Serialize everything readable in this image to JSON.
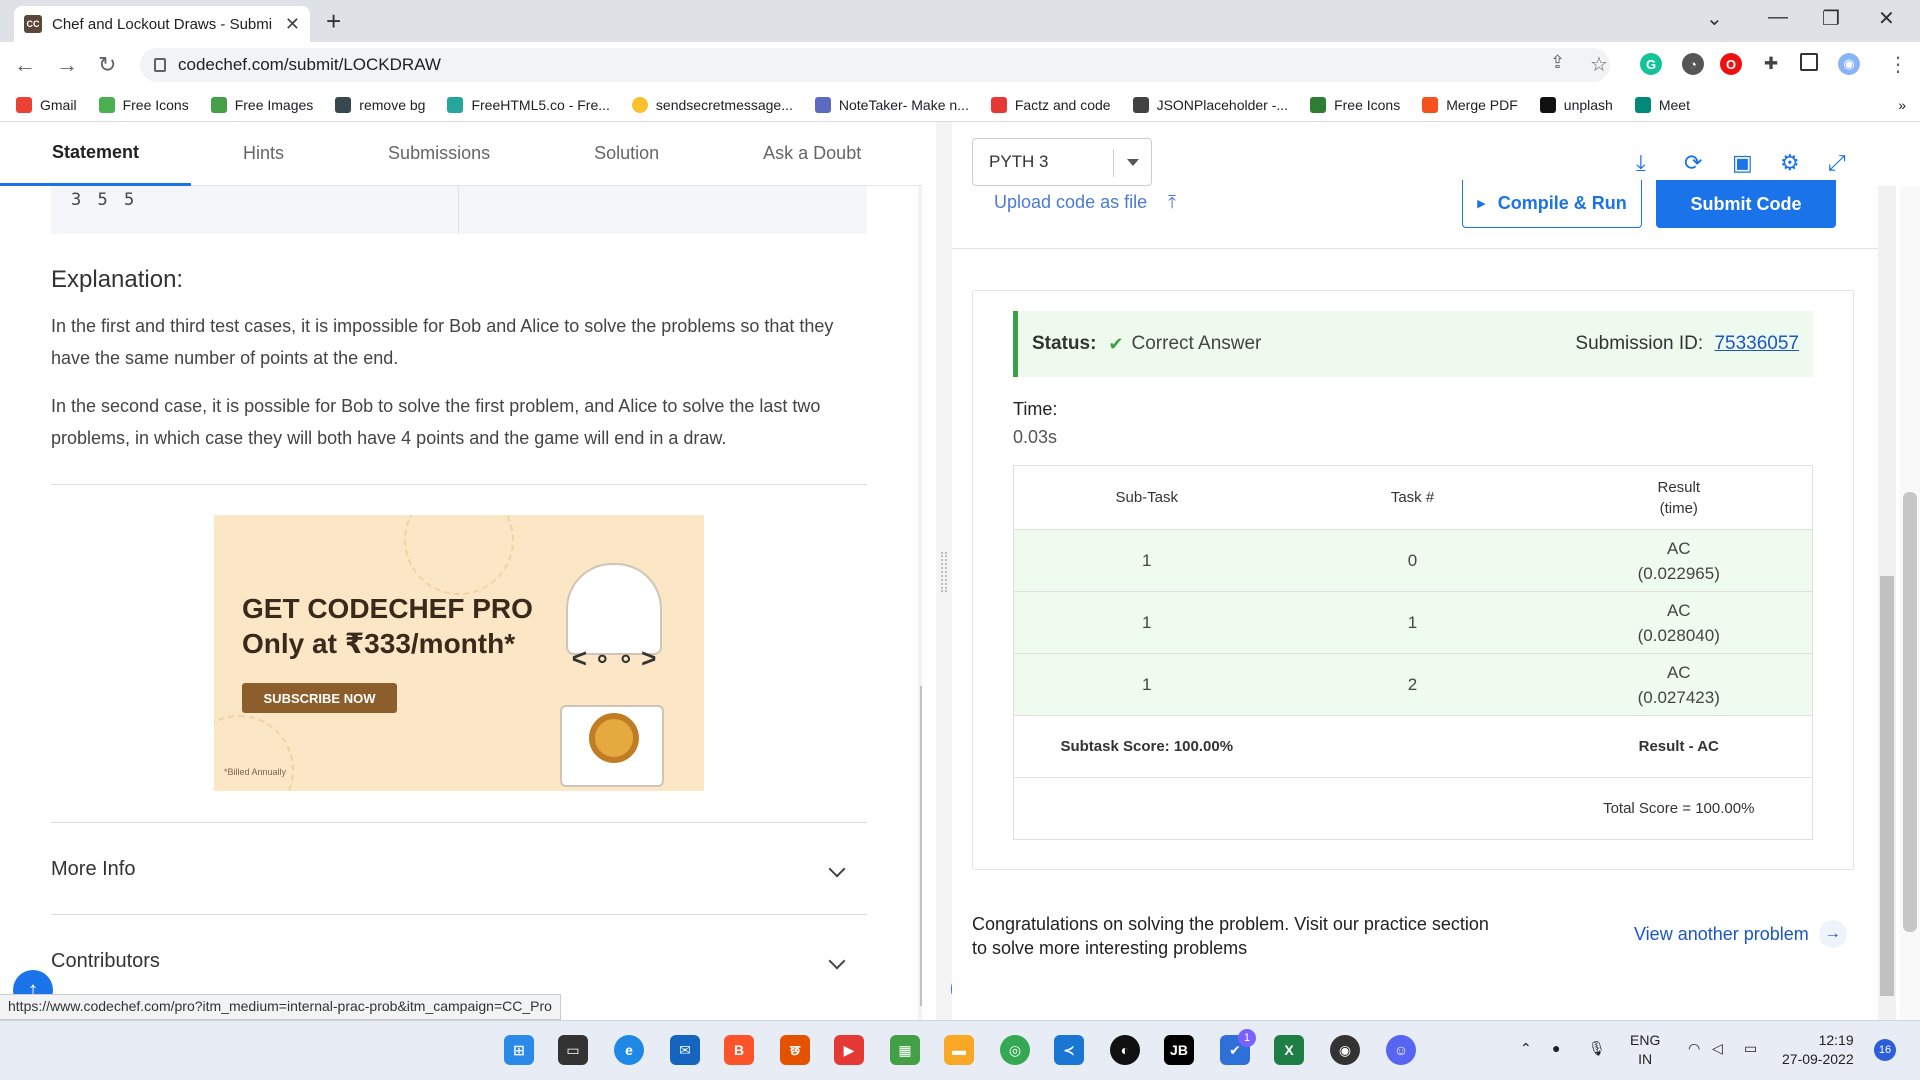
{
  "browser": {
    "tab_title": "Chef and Lockout Draws - Submi",
    "favicon_text": "CC",
    "url": "codechef.com/submit/LOCKDRAW",
    "bookmarks": [
      {
        "label": "Gmail",
        "color": "#ea4335"
      },
      {
        "label": "Free Icons",
        "color": "#4caf50"
      },
      {
        "label": "Free Images",
        "color": "#43a047"
      },
      {
        "label": "remove bg",
        "color": "#37474f"
      },
      {
        "label": "FreeHTML5.co - Fre...",
        "color": "#26a69a"
      },
      {
        "label": "sendsecretmessage...",
        "color": "#fbc02d"
      },
      {
        "label": "NoteTaker- Make n...",
        "color": "#5c6bc0"
      },
      {
        "label": "Factz and code",
        "color": "#e53935"
      },
      {
        "label": "JSONPlaceholder -...",
        "color": "#424242"
      },
      {
        "label": "Free Icons",
        "color": "#2e7d32"
      },
      {
        "label": "Merge PDF",
        "color": "#f4511e"
      },
      {
        "label": "unplash",
        "color": "#111111"
      },
      {
        "label": "Meet",
        "color": "#00897b"
      }
    ],
    "more": "»"
  },
  "problem": {
    "tabs": [
      {
        "label": "Statement",
        "active": true
      },
      {
        "label": "Hints",
        "active": false
      },
      {
        "label": "Submissions",
        "active": false
      },
      {
        "label": "Solution",
        "active": false
      },
      {
        "label": "Ask a Doubt",
        "active": false
      }
    ],
    "sample_output": "3 5 5",
    "explanation_title": "Explanation:",
    "explanation_p1": "In the first and third test cases, it is impossible for Bob and Alice to solve the problems so that they have the same number of points at the end.",
    "explanation_p2": "In the second case, it is possible for Bob to solve the first problem, and Alice to solve the last two problems, in which case they will both have 4 points and the game will end in a draw.",
    "ad": {
      "line1": "GET CODECHEF PRO",
      "line2": "Only at ₹333/month*",
      "button": "SUBSCRIBE NOW",
      "note": "*Billed Annually"
    },
    "more_info": "More Info",
    "contributors": "Contributors"
  },
  "editor": {
    "language": "PYTH 3",
    "upload_label": "Upload code as file",
    "compile_label": "Compile & Run",
    "submit_label": "Submit Code"
  },
  "result": {
    "status_label": "Status:",
    "status_value": "Correct Answer",
    "submission_label": "Submission ID:",
    "submission_id": "75336057",
    "time_label": "Time:",
    "time_value": "0.03s",
    "headers": [
      "Sub-Task",
      "Task #",
      "Result\n(time)"
    ],
    "rows": [
      {
        "subtask": "1",
        "task": "0",
        "result": "AC",
        "time": "(0.022965)"
      },
      {
        "subtask": "1",
        "task": "1",
        "result": "AC",
        "time": "(0.028040)"
      },
      {
        "subtask": "1",
        "task": "2",
        "result": "AC",
        "time": "(0.027423)"
      }
    ],
    "subtask_score": "Subtask Score: 100.00%",
    "result_ac": "Result - AC",
    "total_score": "Total Score = 100.00%",
    "congrats": "Congratulations on solving the problem. Visit our practice section to solve more interesting problems",
    "view_another": "View another problem"
  },
  "status_url": "https://www.codechef.com/pro?itm_medium=internal-prac-prob&itm_campaign=CC_Pro",
  "taskbar": {
    "lang": "ENG",
    "region": "IN",
    "time": "12:19",
    "date": "27-09-2022",
    "notif_count": "16",
    "todo_badge": "1"
  },
  "colors": {
    "accent": "#1a73e8",
    "success": "#3aa14a",
    "link": "#1a56c8"
  }
}
